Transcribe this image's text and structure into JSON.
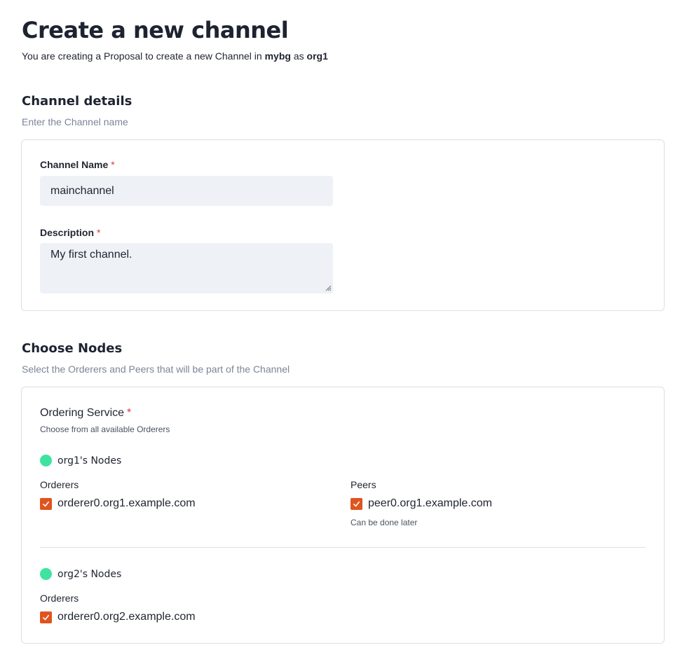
{
  "page": {
    "title": "Create a new channel",
    "subtitle_prefix": "You are creating a Proposal to create a new Channel in ",
    "subtitle_network": "mybg",
    "subtitle_middle": " as ",
    "subtitle_org": "org1"
  },
  "channel_details": {
    "title": "Channel details",
    "description": "Enter the Channel name",
    "name_label": "Channel Name",
    "name_value": "mainchannel",
    "description_label": "Description",
    "description_value": "My first channel.",
    "required_mark": "*"
  },
  "choose_nodes": {
    "title": "Choose Nodes",
    "description": "Select the Orderers and Peers that will be part of the Channel",
    "ordering_service_label": "Ordering Service",
    "ordering_service_desc": "Choose from all available Orderers",
    "required_mark": "*",
    "orgs": [
      {
        "name": "org1's Nodes",
        "orderers_label": "Orderers",
        "orderers": [
          "orderer0.org1.example.com"
        ],
        "peers_label": "Peers",
        "peers": [
          "peer0.org1.example.com"
        ],
        "peers_hint": "Can be done later"
      },
      {
        "name": "org2's Nodes",
        "orderers_label": "Orderers",
        "orderers": [
          "orderer0.org2.example.com"
        ]
      }
    ]
  },
  "colors": {
    "accent_checkbox": "#e0541e",
    "org_dot": "#3ee3a0",
    "required": "#e0383e",
    "input_bg": "#eef2f6"
  }
}
